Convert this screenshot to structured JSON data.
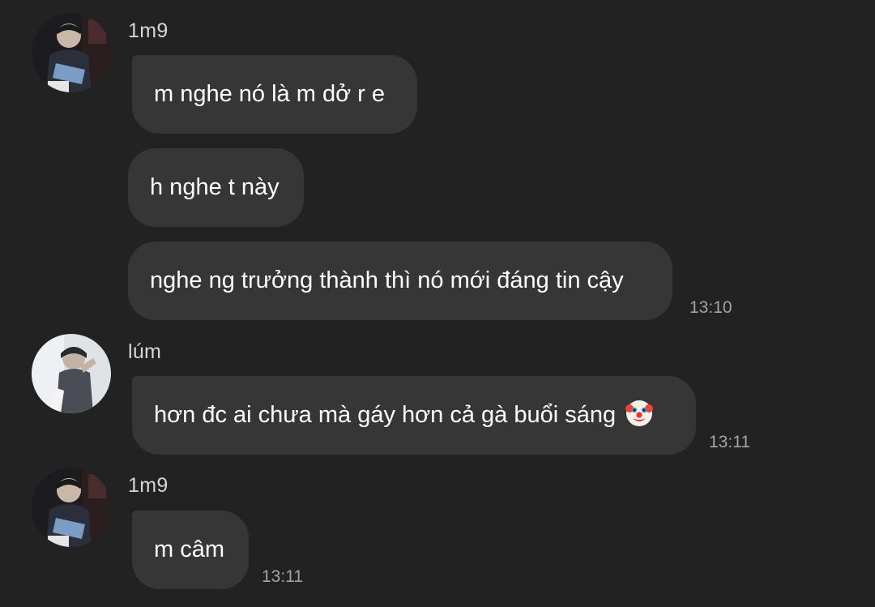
{
  "messages": [
    {
      "sender": "1m9",
      "avatar": "user-1m9-avatar",
      "bubbles": [
        "m nghe nó là m dở r e",
        "h nghe t này",
        "nghe ng trưởng thành thì nó mới đáng tin cậy"
      ],
      "time": "13:10"
    },
    {
      "sender": "lúm",
      "avatar": "user-lum-avatar",
      "bubbles": [
        "hơn đc ai chưa mà gáy hơn cả gà buổi sáng"
      ],
      "emoji": "clown-face-emoji",
      "time": "13:11"
    },
    {
      "sender": "1m9",
      "avatar": "user-1m9-avatar",
      "bubbles": [
        "m câm"
      ],
      "time": "13:11"
    }
  ],
  "colors": {
    "background": "#222222",
    "bubble": "#363636",
    "text": "#ffffff",
    "sender": "#d6d6d6",
    "timestamp": "#a3a3a3"
  }
}
